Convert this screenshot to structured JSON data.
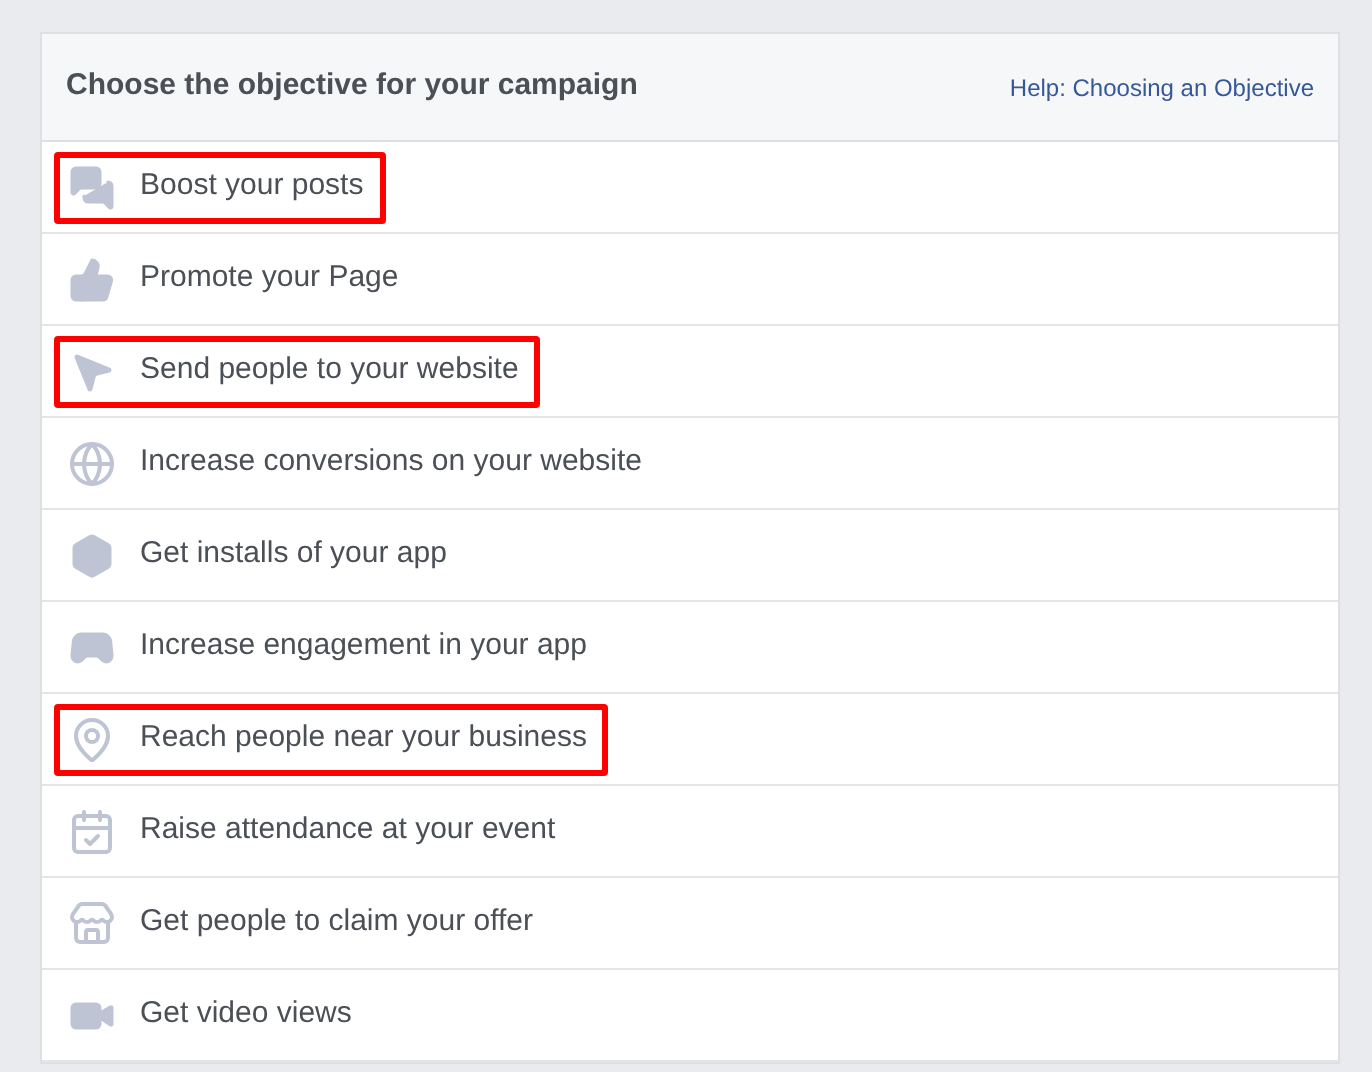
{
  "header": {
    "title": "Choose the objective for your campaign",
    "help_link": "Help: Choosing an Objective"
  },
  "objectives": [
    {
      "kind": "posts",
      "label": "Boost your posts",
      "highlighted": true
    },
    {
      "kind": "page",
      "label": "Promote your Page",
      "highlighted": false
    },
    {
      "kind": "website",
      "label": "Send people to your website",
      "highlighted": true
    },
    {
      "kind": "conversions",
      "label": "Increase conversions on your website",
      "highlighted": false
    },
    {
      "kind": "installs",
      "label": "Get installs of your app",
      "highlighted": false
    },
    {
      "kind": "engagement",
      "label": "Increase engagement in your app",
      "highlighted": false
    },
    {
      "kind": "local",
      "label": "Reach people near your business",
      "highlighted": true
    },
    {
      "kind": "event",
      "label": "Raise attendance at your event",
      "highlighted": false
    },
    {
      "kind": "offer",
      "label": "Get people to claim your offer",
      "highlighted": false
    },
    {
      "kind": "video",
      "label": "Get video views",
      "highlighted": false
    }
  ]
}
